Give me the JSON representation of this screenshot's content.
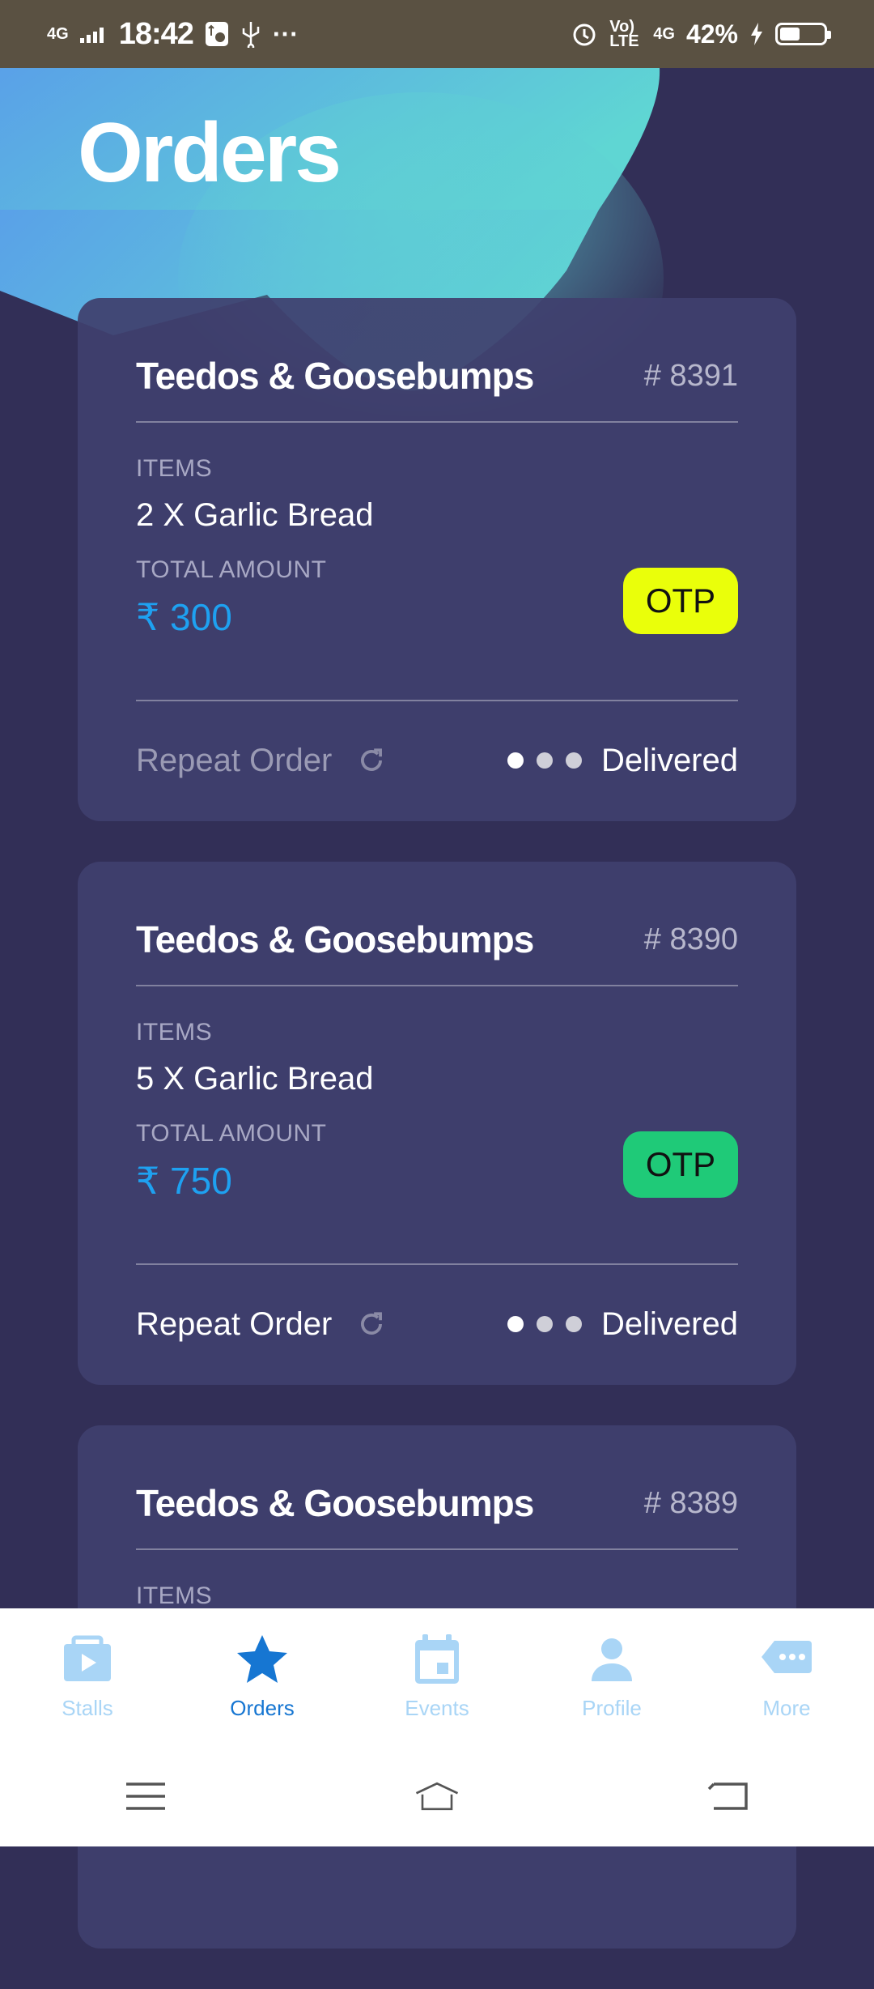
{
  "status_bar": {
    "network": "4G",
    "time": "18:42",
    "more": "···",
    "volte": "Vo) LTE",
    "network2": "4G",
    "battery_percent": "42%",
    "battery_level": 0.42
  },
  "page": {
    "title": "Orders"
  },
  "colors": {
    "background": "#322f57",
    "card": "#3f3f6e",
    "amount": "#1ea1f1",
    "otp_yellow": "#eaff0a",
    "otp_green": "#1fca78",
    "nav_active": "#1676d2",
    "nav_inactive": "#a9d5f6"
  },
  "orders": [
    {
      "stall": "Teedos & Goosebumps",
      "order_no": "# 8391",
      "items_label": "ITEMS",
      "items": "2 X Garlic Bread",
      "total_label": "TOTAL AMOUNT",
      "amount": "₹ 300",
      "otp_label": "OTP",
      "otp_color": "#eaff0a",
      "repeat_label": "Repeat Order",
      "repeat_enabled": false,
      "status": "Delivered"
    },
    {
      "stall": "Teedos & Goosebumps",
      "order_no": "# 8390",
      "items_label": "ITEMS",
      "items": "5 X Garlic Bread",
      "total_label": "TOTAL AMOUNT",
      "amount": "₹ 750",
      "otp_label": "OTP",
      "otp_color": "#1fca78",
      "repeat_label": "Repeat Order",
      "repeat_enabled": true,
      "status": "Delivered"
    },
    {
      "stall": "Teedos & Goosebumps",
      "order_no": "# 8389",
      "items_label": "ITEMS"
    }
  ],
  "bottom_nav": [
    {
      "label": "Stalls",
      "icon": "stalls-icon",
      "active": false
    },
    {
      "label": "Orders",
      "icon": "star-icon",
      "active": true
    },
    {
      "label": "Events",
      "icon": "calendar-icon",
      "active": false
    },
    {
      "label": "Profile",
      "icon": "person-icon",
      "active": false
    },
    {
      "label": "More",
      "icon": "more-icon",
      "active": false
    }
  ]
}
